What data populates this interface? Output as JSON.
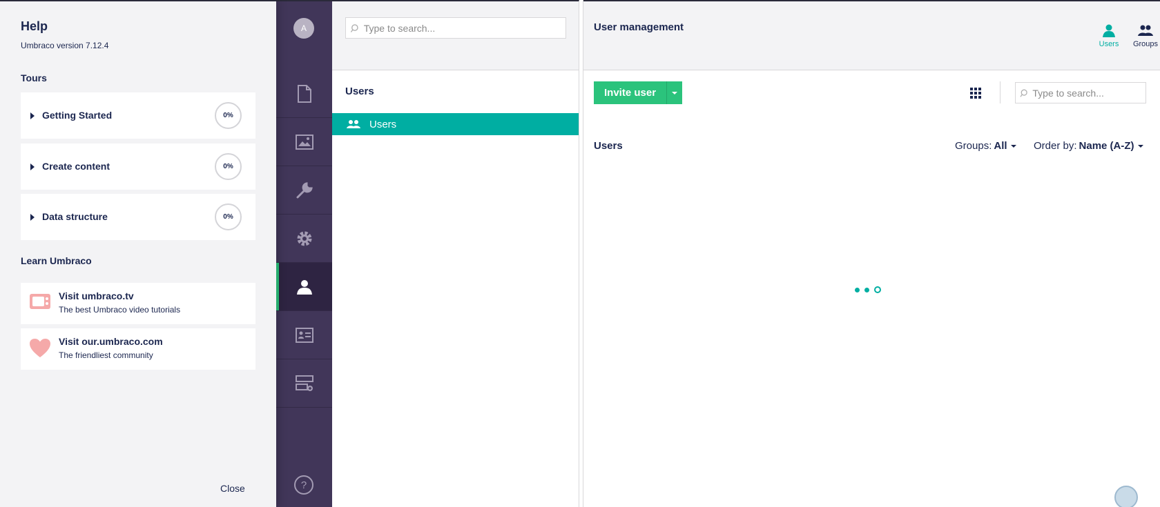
{
  "help": {
    "title": "Help",
    "version": "Umbraco version 7.12.4",
    "tours_heading": "Tours",
    "tours": [
      {
        "label": "Getting Started",
        "progress": "0%"
      },
      {
        "label": "Create content",
        "progress": "0%"
      },
      {
        "label": "Data structure",
        "progress": "0%"
      }
    ],
    "learn_heading": "Learn Umbraco",
    "learn": [
      {
        "title": "Visit umbraco.tv",
        "desc": "The best Umbraco video tutorials",
        "icon": "tv-icon"
      },
      {
        "title": "Visit our.umbraco.com",
        "desc": "The friendliest community",
        "icon": "heart-icon"
      }
    ],
    "close_label": "Close"
  },
  "sections": {
    "avatar_initial": "A",
    "items": [
      "content-icon",
      "media-icon",
      "settings-wrench-icon",
      "developer-gear-icon",
      "users-icon",
      "members-icon",
      "forms-icon"
    ],
    "active": "users-icon"
  },
  "tree": {
    "search_placeholder": "Type to search...",
    "title": "Users",
    "node_label": "Users"
  },
  "main": {
    "title": "User management",
    "tabs": [
      {
        "label": "Users",
        "active": true
      },
      {
        "label": "Groups",
        "active": false
      }
    ],
    "invite_label": "Invite user",
    "search_placeholder": "Type to search...",
    "list_title": "Users",
    "groups_filter_label": "Groups:",
    "groups_filter_value": "All",
    "order_label": "Order by:",
    "order_value": "Name (A-Z)"
  },
  "colors": {
    "accent_teal": "#00aea2",
    "green_button": "#2bc37c",
    "sidebar_purple": "#413659",
    "tour_icon_pink": "#f5a9a9"
  }
}
